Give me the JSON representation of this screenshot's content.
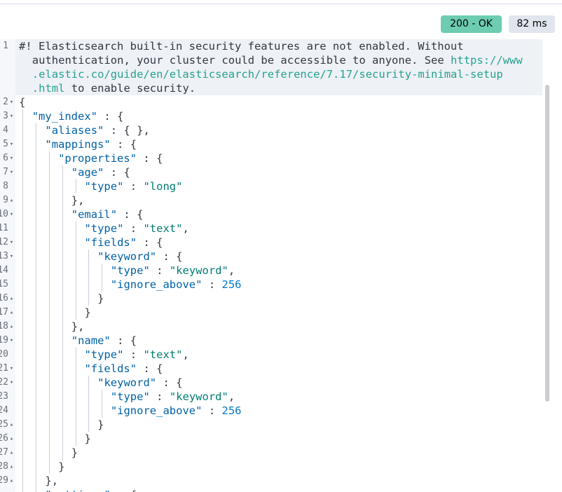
{
  "status": {
    "code_label": "200 - OK",
    "time_label": "82 ms",
    "ok_color": "#6dccb1"
  },
  "editor": {
    "comment": [
      "#! Elasticsearch built-in security features are not enabled. Without",
      "authentication, your cluster could be accessible to anyone. See https://www",
      ".elastic.co/guide/en/elasticsearch/reference/7.17/security-minimal-setup",
      ".html to enable security."
    ],
    "gutter": [
      "1",
      "2",
      "3",
      "4",
      "5",
      "6",
      "7",
      "8",
      "9",
      "10",
      "11",
      "12",
      "13",
      "14",
      "15",
      "16",
      "17",
      "18",
      "19",
      "20",
      "21",
      "22",
      "23",
      "24",
      "25",
      "26",
      "27",
      "28",
      "29"
    ],
    "lines": [
      "{",
      "  \"my_index\" : {",
      "    \"aliases\" : { },",
      "    \"mappings\" : {",
      "      \"properties\" : {",
      "        \"age\" : {",
      "          \"type\" : \"long\"",
      "        },",
      "        \"email\" : {",
      "          \"type\" : \"text\",",
      "          \"fields\" : {",
      "            \"keyword\" : {",
      "              \"type\" : \"keyword\",",
      "              \"ignore_above\" : 256",
      "            }",
      "          }",
      "        },",
      "        \"name\" : {",
      "          \"type\" : \"text\",",
      "          \"fields\" : {",
      "            \"keyword\" : {",
      "              \"type\" : \"keyword\",",
      "              \"ignore_above\" : 256",
      "            }",
      "          }",
      "        }",
      "      }",
      "    },",
      "    \"settings\" : {"
    ]
  }
}
